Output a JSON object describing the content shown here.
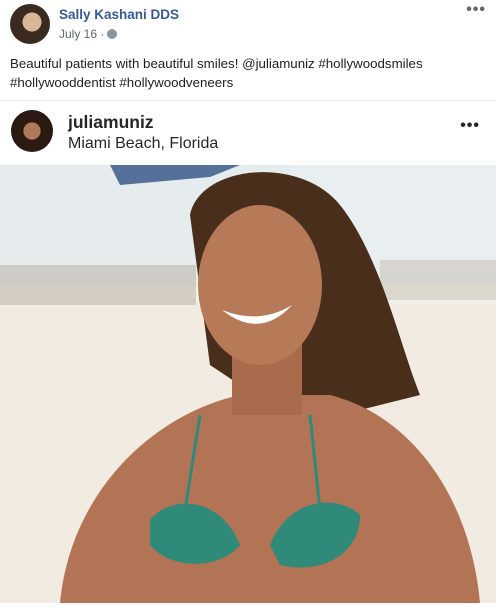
{
  "post": {
    "author": "Sally Kashani DDS",
    "date": "July 16 ·",
    "privacy_icon": "globe-icon",
    "more_icon": "•••",
    "text_line1": "Beautiful patients with beautiful smiles! @juliamuniz #hollywoodsmiles",
    "text_line2": "#hollywooddentist #hollywoodveneers"
  },
  "embed": {
    "username": "juliamuniz",
    "location": "Miami Beach, Florida",
    "more_icon": "•••"
  }
}
